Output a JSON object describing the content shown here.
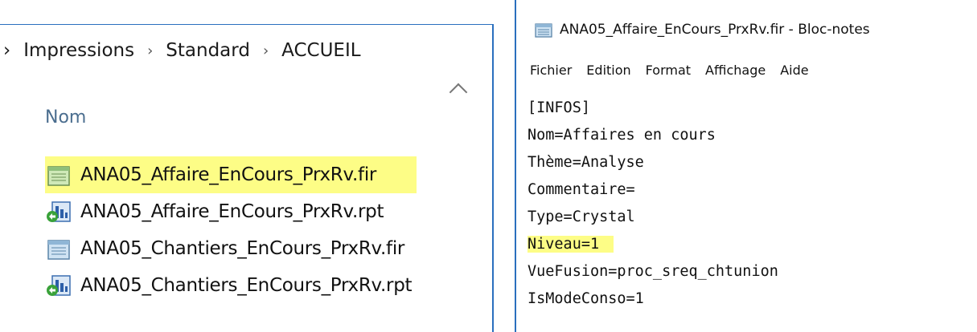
{
  "explorer": {
    "breadcrumb": [
      "Impressions",
      "Standard",
      "ACCUEIL"
    ],
    "column_header": "Nom",
    "files": [
      {
        "name": "ANA05_Affaire_EnCours_PrxRv.fir",
        "icon": "notepad-file-icon",
        "highlighted": true
      },
      {
        "name": "ANA05_Affaire_EnCours_PrxRv.rpt",
        "icon": "crystal-report-icon",
        "highlighted": false
      },
      {
        "name": "ANA05_Chantiers_EnCours_PrxRv.fir",
        "icon": "notepad-file-icon",
        "highlighted": false
      },
      {
        "name": "ANA05_Chantiers_EnCours_PrxRv.rpt",
        "icon": "crystal-report-icon",
        "highlighted": false
      }
    ]
  },
  "notepad": {
    "title": "ANA05_Affaire_EnCours_PrxRv.fir - Bloc-notes",
    "menu": [
      "Fichier",
      "Edition",
      "Format",
      "Affichage",
      "Aide"
    ],
    "lines": [
      "[INFOS]",
      "Nom=Affaires en cours",
      "Thème=Analyse",
      "Commentaire=",
      "Type=Crystal",
      "Niveau=1",
      "VueFusion=proc_sreq_chtunion",
      "IsModeConso=1"
    ]
  },
  "colors": {
    "highlight": "#fdfd86",
    "window_border": "#2a6fbe",
    "column_header": "#4b6e8f"
  }
}
